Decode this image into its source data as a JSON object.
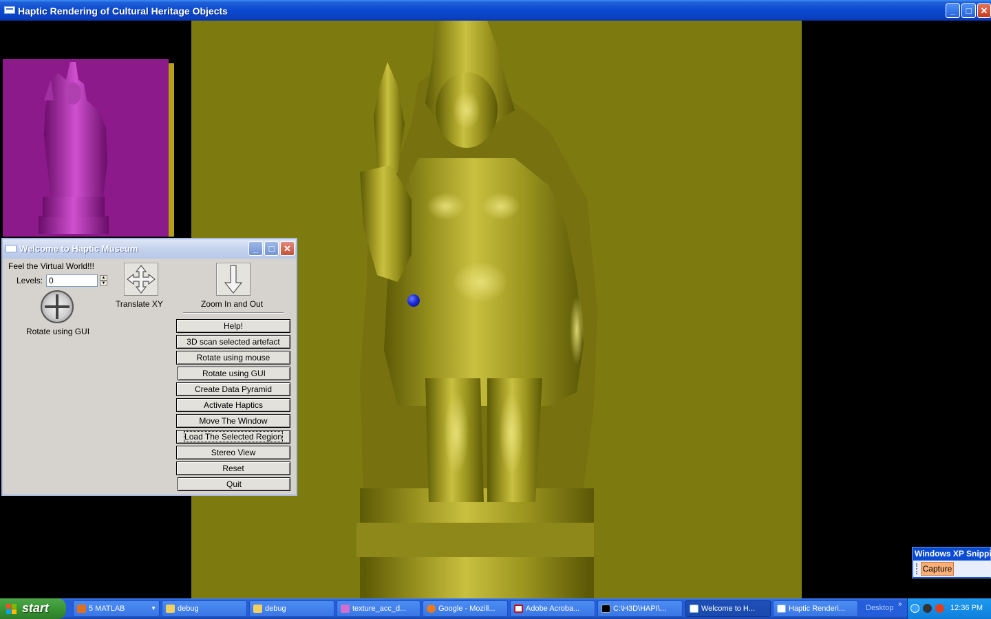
{
  "main_window": {
    "title": "Haptic Rendering of Cultural Heritage Objects",
    "controls": {
      "minimize": "_",
      "maximize": "□",
      "close": "✕"
    }
  },
  "dialog": {
    "title": "Welcome to Haptic Museum",
    "controls": {
      "minimize": "_",
      "maximize": "□",
      "close": "✕"
    },
    "feel_text": "Feel the Virtual World!!!",
    "levels_label": "Levels:",
    "levels_value": "0",
    "rotate_gui_label": "Rotate using GUI",
    "translate_label": "Translate XY",
    "zoom_label": "Zoom In and Out",
    "buttons": [
      "Help!",
      "3D scan selected artefact",
      "Rotate using mouse",
      "Rotate using GUI",
      "Create Data Pyramid",
      "Activate Haptics",
      "Move The Window",
      "Load The Selected Region",
      "Stereo View",
      "Reset",
      "Quit"
    ]
  },
  "snipping_tool": {
    "title": "Windows XP Snipping",
    "capture_label": "Capture"
  },
  "taskbar": {
    "start_label": "start",
    "tasks": [
      {
        "label": "5 MATLAB",
        "icon": "matlab-icon"
      },
      {
        "label": "debug",
        "icon": "folder-icon"
      },
      {
        "label": "debug",
        "icon": "folder-icon"
      },
      {
        "label": "texture_acc_d...",
        "icon": "image-icon"
      },
      {
        "label": "Google - Mozill...",
        "icon": "firefox-icon"
      },
      {
        "label": "Adobe Acroba...",
        "icon": "acrobat-icon"
      },
      {
        "label": "C:\\H3D\\HAPI\\...",
        "icon": "console-icon"
      },
      {
        "label": "Welcome to H...",
        "icon": "app-window-icon"
      },
      {
        "label": "Haptic Renderi...",
        "icon": "app-window-icon"
      }
    ],
    "desktop_label": "Desktop",
    "clock": "12:36 PM"
  },
  "colors": {
    "canvas_background": "#7d7a10",
    "statue_color": "#a9a12a",
    "thumb_background": "#8c1a8a",
    "thumb_statue": "#c040c0",
    "cursor_ball": "#1b2bd8"
  }
}
